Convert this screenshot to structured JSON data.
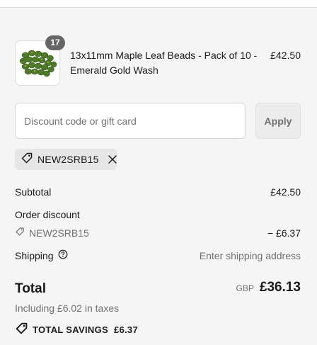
{
  "product": {
    "quantity": "17",
    "title": "13x11mm Maple Leaf Beads - Pack of 10 - Emerald Gold Wash",
    "price": "£42.50"
  },
  "discount": {
    "placeholder": "Discount code or gift card",
    "apply_label": "Apply",
    "applied_code": "NEW2SRB15"
  },
  "summary": {
    "subtotal_label": "Subtotal",
    "subtotal_value": "£42.50",
    "order_discount_label": "Order discount",
    "discount_code": "NEW2SRB15",
    "discount_value": "− £6.37",
    "shipping_label": "Shipping",
    "shipping_value": "Enter shipping address",
    "total_label": "Total",
    "currency": "GBP",
    "total_value": "£36.13",
    "tax_note": "Including £6.02 in taxes",
    "savings_label": "TOTAL SAVINGS",
    "savings_value": "£6.37"
  },
  "icons": {
    "tag": "tag-icon",
    "close": "close-icon",
    "help": "help-circle-icon",
    "savings_tag": "savings-tag-icon"
  },
  "colors": {
    "background": "#f5f5f5",
    "text": "#1a1a1a",
    "muted": "#707070",
    "badge": "#666666",
    "bead_green": "#4e7a2a"
  }
}
